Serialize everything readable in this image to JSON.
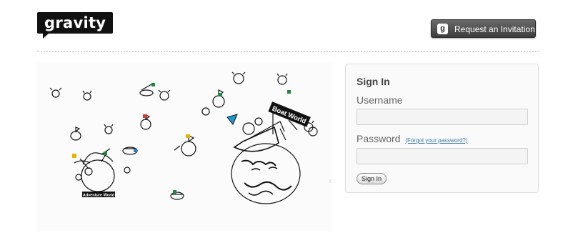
{
  "header": {
    "logo_text": "gravity",
    "invite_button_label": "Request an Invitation",
    "invite_icon_glyph": "g"
  },
  "illustration": {
    "adventure_world_label": "Adventure World",
    "boat_world_label": "Boat World",
    "carousel_arrow": "‹"
  },
  "signin": {
    "title": "Sign In",
    "username_label": "Username",
    "username_value": "",
    "password_label": "Password",
    "forgot_link": "(Forgot your password?)",
    "password_value": "",
    "submit_label": "Sign In"
  },
  "colors": {
    "brand": "#111111",
    "link": "#3a78b0",
    "button_dark": "#4a4a4a"
  }
}
